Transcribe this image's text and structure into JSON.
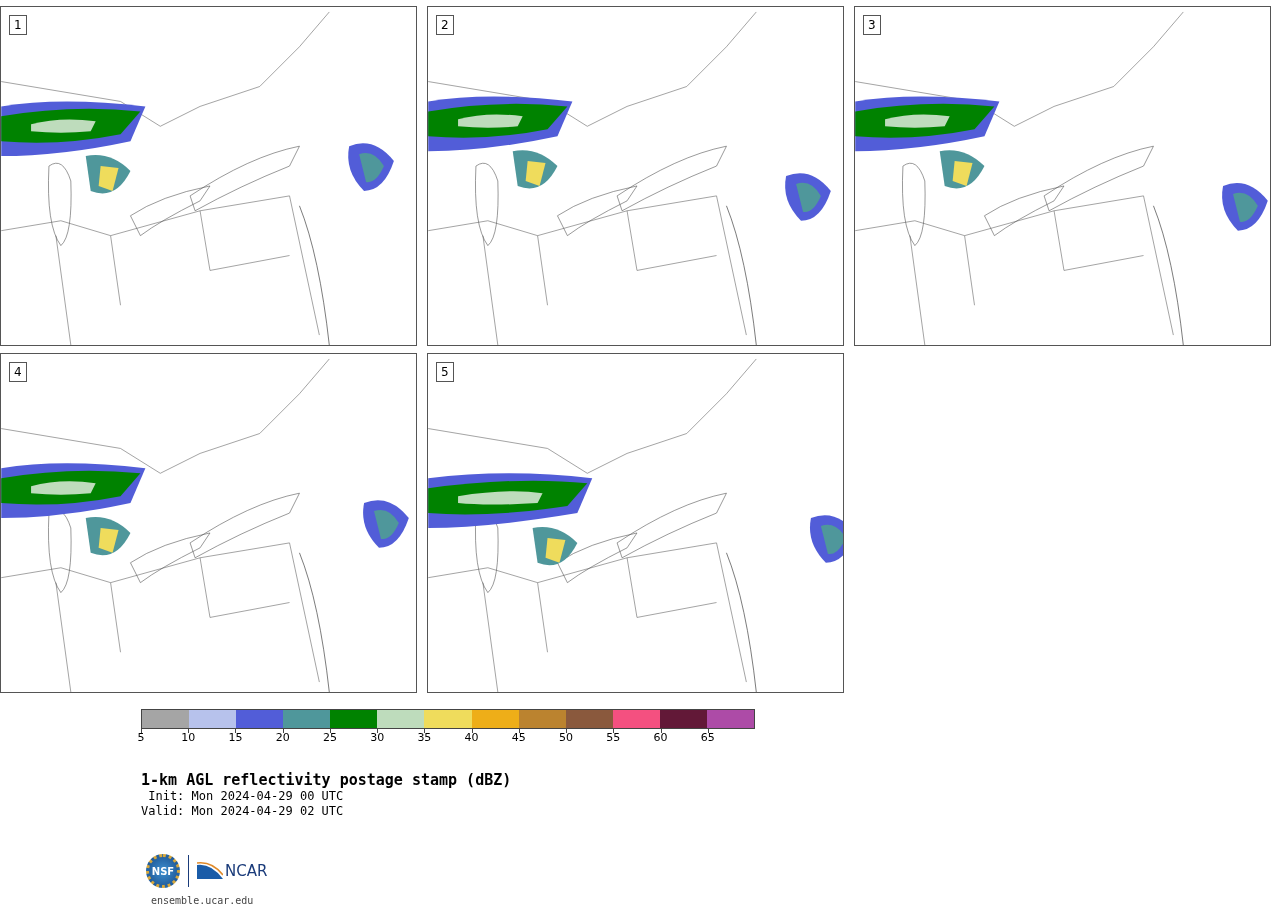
{
  "panels": [
    {
      "label": "1"
    },
    {
      "label": "2"
    },
    {
      "label": "3"
    },
    {
      "label": "4"
    },
    {
      "label": "5"
    }
  ],
  "colorbar": {
    "segments": [
      {
        "color": "#a5a5a5"
      },
      {
        "color": "#b7c2ec"
      },
      {
        "color": "#525dd8"
      },
      {
        "color": "#4f979b"
      },
      {
        "color": "#008200"
      },
      {
        "color": "#bedcbc"
      },
      {
        "color": "#efdc5c"
      },
      {
        "color": "#eeae18"
      },
      {
        "color": "#bb832f"
      },
      {
        "color": "#8a593d"
      },
      {
        "color": "#f45080"
      },
      {
        "color": "#621837"
      },
      {
        "color": "#ad4ba7"
      }
    ],
    "ticks": [
      "5",
      "10",
      "15",
      "20",
      "25",
      "30",
      "35",
      "40",
      "45",
      "50",
      "55",
      "60",
      "65"
    ]
  },
  "title": "1-km AGL reflectivity postage stamp (dBZ)",
  "init": " Init: Mon 2024-04-29 00 UTC",
  "valid": "Valid: Mon 2024-04-29 02 UTC",
  "logos": {
    "nsf": "NSF",
    "ncar": "NCAR"
  },
  "url": "ensemble.ucar.edu"
}
